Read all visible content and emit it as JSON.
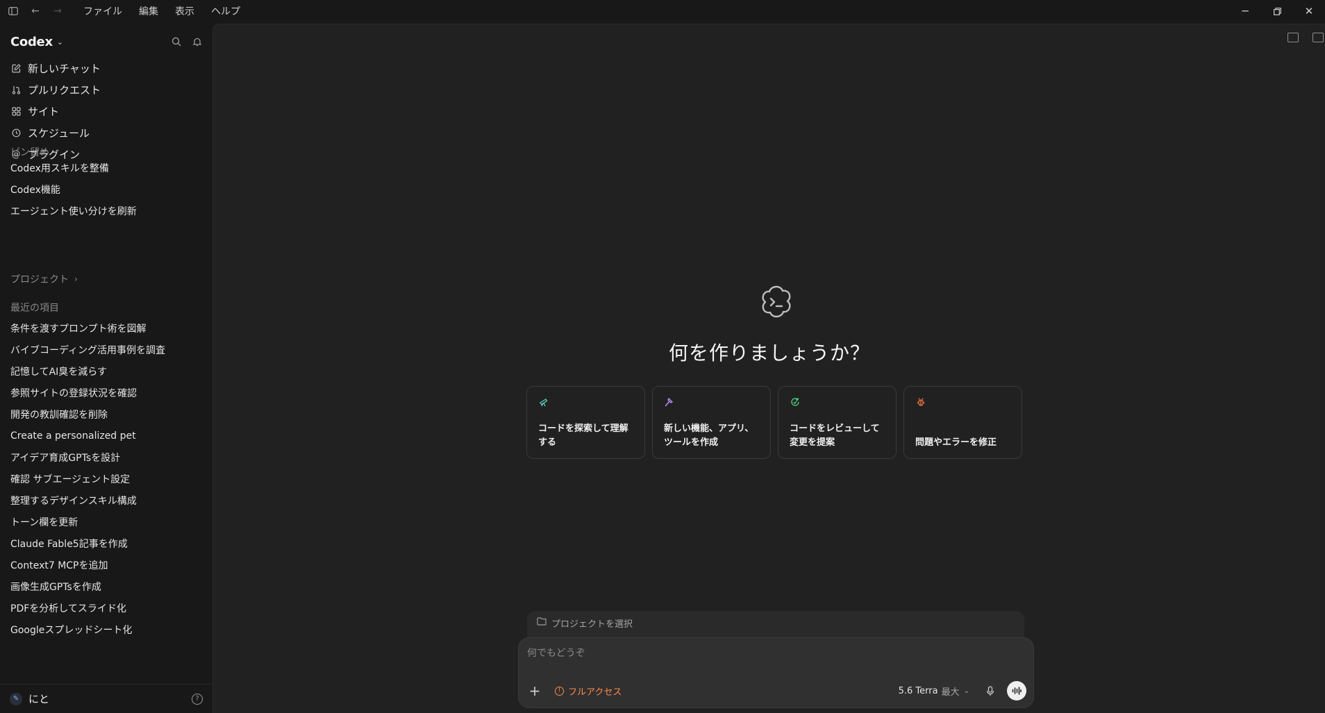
{
  "menu": [
    "ファイル",
    "編集",
    "表示",
    "ヘルプ"
  ],
  "brand": "Codex",
  "nav": [
    {
      "label": "新しいチャット",
      "icon": "edit-icon"
    },
    {
      "label": "プルリクエスト",
      "icon": "pull-request-icon"
    },
    {
      "label": "サイト",
      "icon": "sites-icon"
    },
    {
      "label": "スケジュール",
      "icon": "clock-icon"
    },
    {
      "label": "プラグイン",
      "icon": "plugin-icon"
    }
  ],
  "pinned": {
    "label": "ピン留め",
    "items": [
      "Codex用スキルを整備",
      "Codex機能",
      "エージェント使い分けを刷新"
    ]
  },
  "projects": {
    "label": "プロジェクト"
  },
  "recent": {
    "label": "最近の項目",
    "items": [
      "条件を渡すプロンプト術を図解",
      "バイブコーディング活用事例を調査",
      "記憶してAI臭を減らす",
      "参照サイトの登録状況を確認",
      "開発の教訓確認を削除",
      "Create a personalized pet",
      "アイデア育成GPTsを設計",
      "確認 サブエージェント設定",
      "整理するデザインスキル構成",
      "トーン欄を更新",
      "Claude Fable5記事を作成",
      "Context7 MCPを追加",
      "画像生成GPTsを作成",
      "PDFを分析してスライド化",
      "Googleスプレッドシート化"
    ]
  },
  "user": {
    "name": "にと"
  },
  "hero": {
    "title": "何を作りましょうか？"
  },
  "cards": [
    {
      "line1": "コードを探索して理解",
      "line2": "する",
      "icon": "telescope-icon",
      "color": "#5fd0c0"
    },
    {
      "line1": "新しい機能、アプリ、",
      "line2": "ツールを作成",
      "icon": "hammer-icon",
      "color": "#c48bff"
    },
    {
      "line1": "コードをレビューして",
      "line2": "変更を提案",
      "icon": "review-icon",
      "color": "#4fd08a"
    },
    {
      "line1": "",
      "line2": "問題やエラーを修正",
      "icon": "bug-icon",
      "color": "#ff7a45"
    }
  ],
  "composer": {
    "project_select": "プロジェクトを選択",
    "placeholder": "何でもどうぞ",
    "access": "フルアクセス",
    "model": "5.6 Terra",
    "effort": "最大"
  },
  "colors": {
    "access": "#ff8a4c",
    "background": "#212121",
    "sidebar": "#181818"
  }
}
